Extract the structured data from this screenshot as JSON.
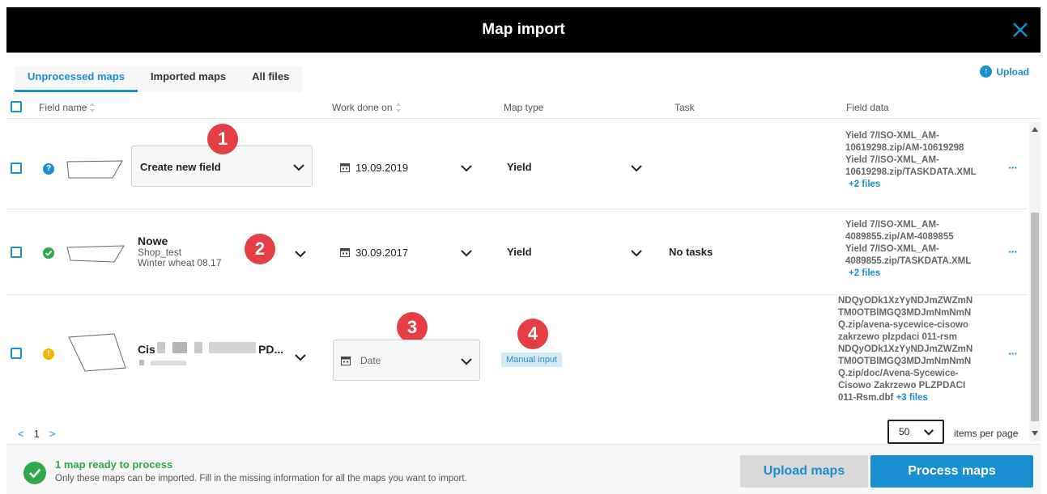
{
  "window": {
    "title": "Map import"
  },
  "tabs": [
    {
      "label": "Unprocessed maps",
      "active": true
    },
    {
      "label": "Imported maps"
    },
    {
      "label": "All files"
    }
  ],
  "upload_link": "Upload",
  "columns": {
    "field_name": "Field name",
    "work_done_on": "Work done on",
    "map_type": "Map type",
    "task": "Task",
    "field_data": "Field data"
  },
  "rows": [
    {
      "status": "unknown",
      "status_glyph": "?",
      "field_select": "Create new field",
      "date": "19.09.2019",
      "map_type": "Yield",
      "task": "",
      "field_data_lines": [
        "Yield 7/ISO-XML_AM-",
        "10619298.zip/AM-10619298",
        "Yield 7/ISO-XML_AM-",
        "10619298.zip/TASKDATA.XML"
      ],
      "field_data_more": "+2 files",
      "badge": "1"
    },
    {
      "status": "ok",
      "field_name": "Nowe",
      "field_farm": "Shop_test",
      "field_crop": "Winter wheat 08.17",
      "date": "30.09.2017",
      "map_type": "Yield",
      "task": "No tasks",
      "field_data_lines": [
        "Yield 7/ISO-XML_AM-",
        "4089855.zip/AM-4089855",
        "Yield 7/ISO-XML_AM-",
        "4089855.zip/TASKDATA.XML"
      ],
      "field_data_more": "+2 files",
      "badge": "2"
    },
    {
      "status": "warning",
      "field_name_visible_start": "Cis",
      "field_name_visible_end": "PD...",
      "date_placeholder": "Date",
      "map_type_button": "Manual input",
      "field_data_lines": [
        "NDQyODk1XzYyNDJmZWZmN",
        "TM0OTBlMGQ3MDJmNmNmN",
        "Q.zip/avena-sycewice-cisowo",
        "zakrzewo plzpdaci 011-rsm",
        "NDQyODk1XzYyNDJmZWZmN",
        "TM0OTBlMGQ3MDJmNmNmN",
        "Q.zip/doc/Avena-Sycewice-",
        "Cisowo Zakrzewo PLZPDACI",
        "011-Rsm.dbf"
      ],
      "field_data_more": "+3 files",
      "badges": [
        "3",
        "4"
      ]
    }
  ],
  "pagination": {
    "prev": "<",
    "page": "1",
    "next": ">",
    "per_page": "50",
    "per_page_label": "items per page"
  },
  "footer": {
    "ready_title": "1 map ready to process",
    "ready_sub": "Only these maps can be imported. Fill in the missing information for all the maps you want to import.",
    "upload_button": "Upload maps",
    "process_button": "Process maps"
  },
  "colors": {
    "accent": "#1a8fd0",
    "success": "#2ea84a",
    "warning": "#f5b400",
    "badge": "#e63e45",
    "titlebar": "#000000"
  }
}
